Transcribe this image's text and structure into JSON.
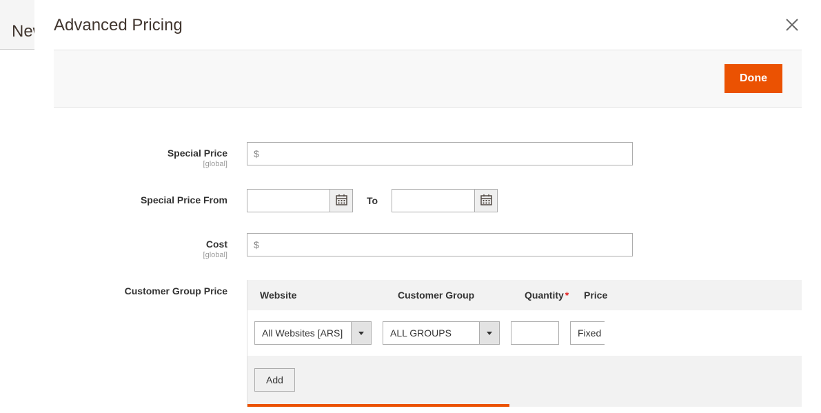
{
  "page_behind": {
    "title": "New"
  },
  "modal": {
    "title": "Advanced Pricing",
    "done_label": "Done"
  },
  "fields": {
    "special_price": {
      "label": "Special Price",
      "scope": "[global]",
      "prefix": "$",
      "value": ""
    },
    "special_price_from": {
      "label": "Special Price From",
      "to_label": "To",
      "from_value": "",
      "to_value": ""
    },
    "cost": {
      "label": "Cost",
      "scope": "[global]",
      "prefix": "$",
      "value": ""
    },
    "customer_group_price": {
      "label": "Customer Group Price",
      "headers": {
        "website": "Website",
        "group": "Customer Group",
        "quantity": "Quantity",
        "price": "Price"
      },
      "row": {
        "website_value": "All Websites [ARS]",
        "group_value": "ALL GROUPS",
        "quantity_value": "",
        "price_type_value": "Fixed"
      },
      "add_label": "Add"
    }
  }
}
